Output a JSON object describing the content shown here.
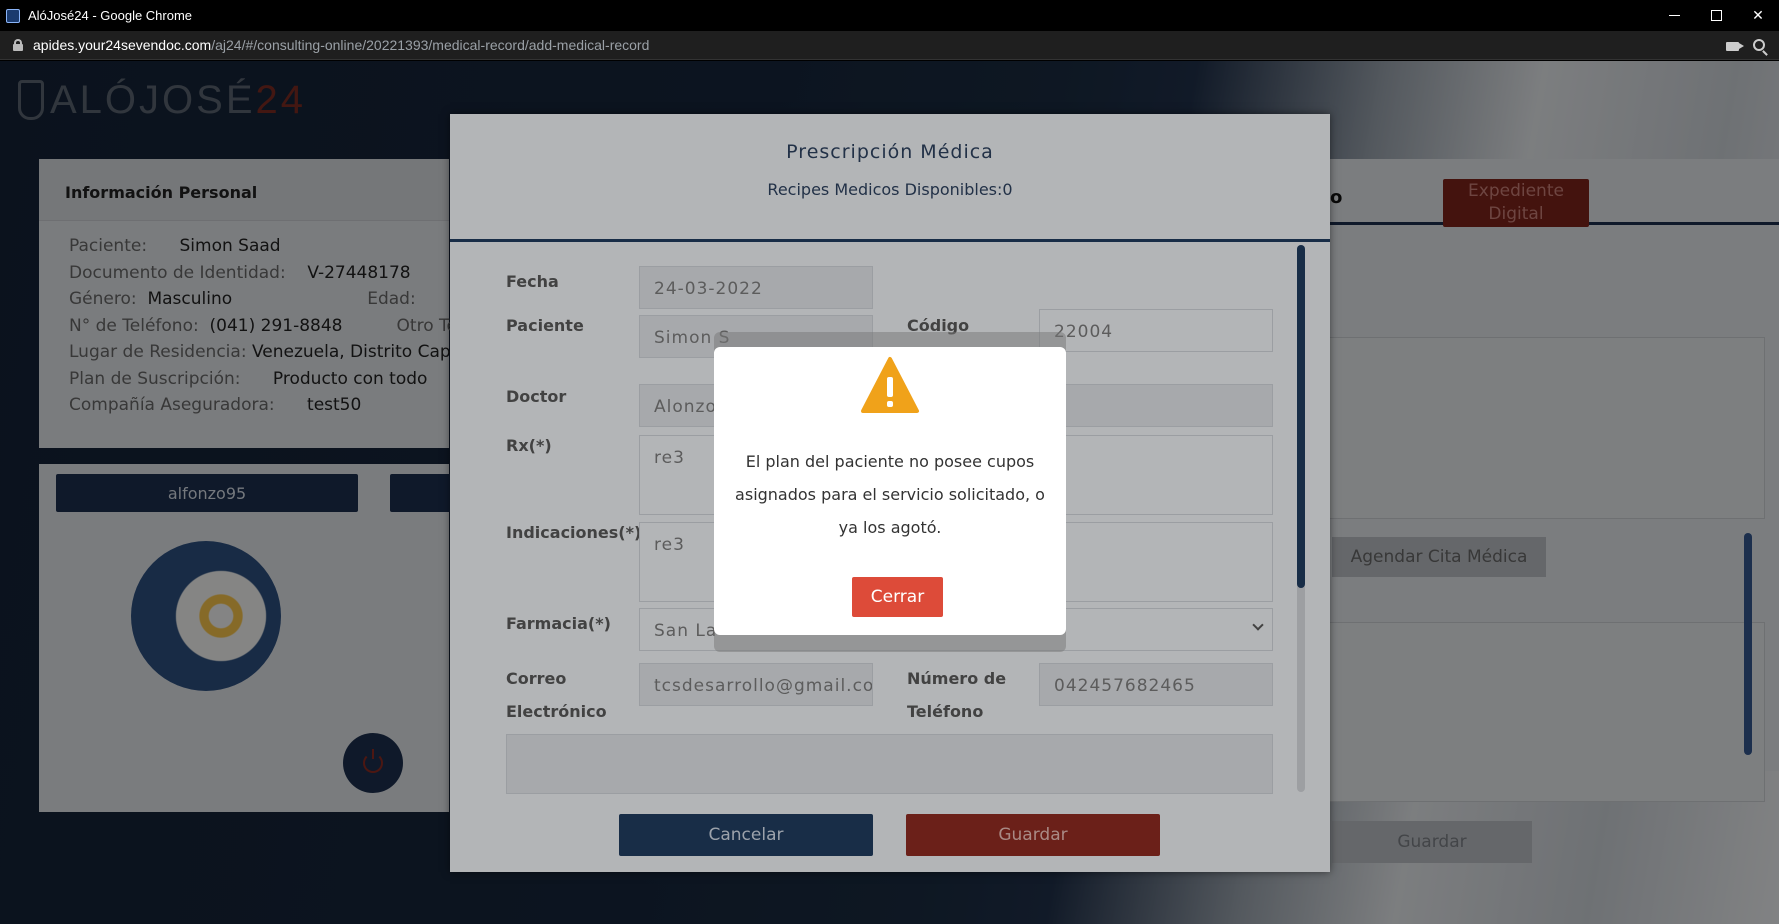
{
  "browser": {
    "title": "AlóJosé24 - Google Chrome",
    "url_host": "apides.your24sevendoc.com",
    "url_path": "/aj24/#/consulting-online/20221393/medical-record/add-medical-record",
    "minimize": "–",
    "close": "✕"
  },
  "logo": {
    "text": "ALÓJOSÉ",
    "number": "24"
  },
  "patient_card": {
    "heading": "Información Personal",
    "rows": [
      {
        "label": "Paciente",
        "value": "Simon Saad"
      },
      {
        "label": "Documento de Identidad",
        "value": "V-27448178"
      },
      {
        "label": "Género",
        "value": "Masculino",
        "label2": "Edad"
      },
      {
        "label": "N° de Teléfono",
        "value": "(041) 291-8848",
        "label2": "Otro Te"
      },
      {
        "label": "Lugar de Residencia",
        "value": "Venezuela, Distrito Cap"
      },
      {
        "label": "Plan de Suscripción",
        "value": "Producto con todo"
      },
      {
        "label": "Compañía Aseguradora",
        "value": "test50"
      }
    ]
  },
  "doctor_card": {
    "tab1": "alfonzo95"
  },
  "right_panel": {
    "heading_fragment": "o",
    "expediente_button": "Expediente Digital",
    "agendar_button": "Agendar Cita Médica",
    "guardar_button": "Guardar"
  },
  "prescription_modal": {
    "title": "Prescripción Médica",
    "subtitle": "Recipes Medicos Disponibles:0",
    "labels": {
      "fecha": "Fecha",
      "paciente": "Paciente",
      "codigo": "Código",
      "doctor": "Doctor",
      "rx": "Rx(*)",
      "indicaciones": "Indicaciones(*)",
      "farmacia": "Farmacia(*)",
      "correo_1": "Correo",
      "correo_2": "Electrónico",
      "telefono_1": "Número de",
      "telefono_2": "Teléfono"
    },
    "values": {
      "fecha": "24-03-2022",
      "paciente": "Simon S",
      "codigo": "22004",
      "doctor": "Alonzo",
      "rx": "re3",
      "indicaciones": "re3",
      "farmacia": "San La",
      "correo": "tcsdesarrollo@gmail.com",
      "telefono": "042457682465"
    },
    "cancel_button": "Cancelar",
    "save_button": "Guardar"
  },
  "alert": {
    "message": "El plan del paciente no posee cupos asignados para el servicio solicitado, o ya los agotó.",
    "button": "Cerrar",
    "icon_color": "#f0a21a"
  }
}
